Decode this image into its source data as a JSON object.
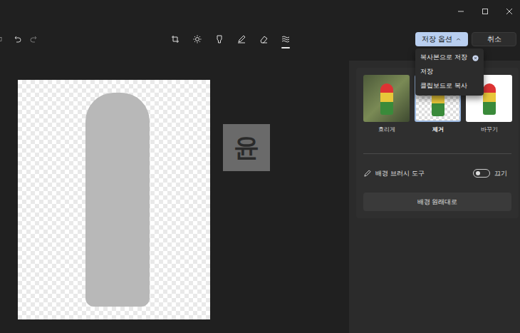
{
  "toolbar": {
    "tools": [
      {
        "kind": "crop",
        "selected": false
      },
      {
        "kind": "adjust",
        "selected": false
      },
      {
        "kind": "filter",
        "selected": false
      },
      {
        "kind": "markup",
        "selected": false
      },
      {
        "kind": "erase",
        "selected": false
      },
      {
        "kind": "background",
        "selected": true
      }
    ],
    "save_options": {
      "label": "저장 옵션",
      "expanded": true
    },
    "cancel": "취소"
  },
  "save_menu": [
    "복사본으로 저장",
    "저장",
    "클립보드로 복사"
  ],
  "watermark": "윤",
  "background_panel": {
    "effects": [
      {
        "label": "흐리게",
        "kind": "blur",
        "selected": false
      },
      {
        "label": "제거",
        "kind": "remove",
        "selected": true
      },
      {
        "label": "바꾸기",
        "kind": "replace",
        "selected": false
      }
    ],
    "brush_tool": {
      "label": "배경 브러시 도구",
      "on": false,
      "state_label": "끄기"
    },
    "reset": "배경 원래대로"
  }
}
